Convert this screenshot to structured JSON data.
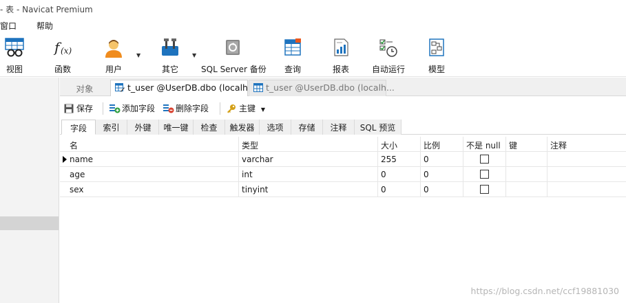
{
  "window": {
    "title": "- 表 - Navicat Premium"
  },
  "menu": {
    "items": [
      "窗口",
      "帮助"
    ]
  },
  "toolbar": {
    "items": [
      {
        "label": "视图",
        "icon": "view-icon"
      },
      {
        "label": "函数",
        "icon": "function-icon"
      },
      {
        "label": "用户",
        "icon": "user-icon"
      },
      {
        "label": "其它",
        "icon": "tools-icon"
      },
      {
        "label": "SQL Server 备份",
        "icon": "backup-icon"
      },
      {
        "label": "查询",
        "icon": "query-icon"
      },
      {
        "label": "报表",
        "icon": "report-icon"
      },
      {
        "label": "自动运行",
        "icon": "schedule-icon"
      },
      {
        "label": "模型",
        "icon": "model-icon"
      }
    ]
  },
  "tabs": {
    "objects": "对象",
    "active": "t_user @UserDB.dbo (localh...",
    "inactive": "t_user @UserDB.dbo (localh..."
  },
  "actions": {
    "save": "保存",
    "add_field": "添加字段",
    "delete_field": "删除字段",
    "primary_key": "主键"
  },
  "subtabs": [
    "字段",
    "索引",
    "外键",
    "唯一键",
    "检查",
    "触发器",
    "选项",
    "存储",
    "注释",
    "SQL 预览"
  ],
  "grid": {
    "columns": [
      "名",
      "类型",
      "大小",
      "比例",
      "不是 null",
      "键",
      "注释"
    ],
    "rows": [
      {
        "name": "name",
        "type": "varchar",
        "size": "255",
        "scale": "0",
        "not_null": false,
        "key": "",
        "comment": ""
      },
      {
        "name": "age",
        "type": "int",
        "size": "0",
        "scale": "0",
        "not_null": false,
        "key": "",
        "comment": ""
      },
      {
        "name": "sex",
        "type": "tinyint",
        "size": "0",
        "scale": "0",
        "not_null": false,
        "key": "",
        "comment": ""
      }
    ]
  },
  "watermark": "https://blog.csdn.net/ccf19881030",
  "colors": {
    "accent": "#1e73be",
    "add": "#2e9e3e",
    "delete": "#d9412f",
    "key": "#d4a017"
  }
}
